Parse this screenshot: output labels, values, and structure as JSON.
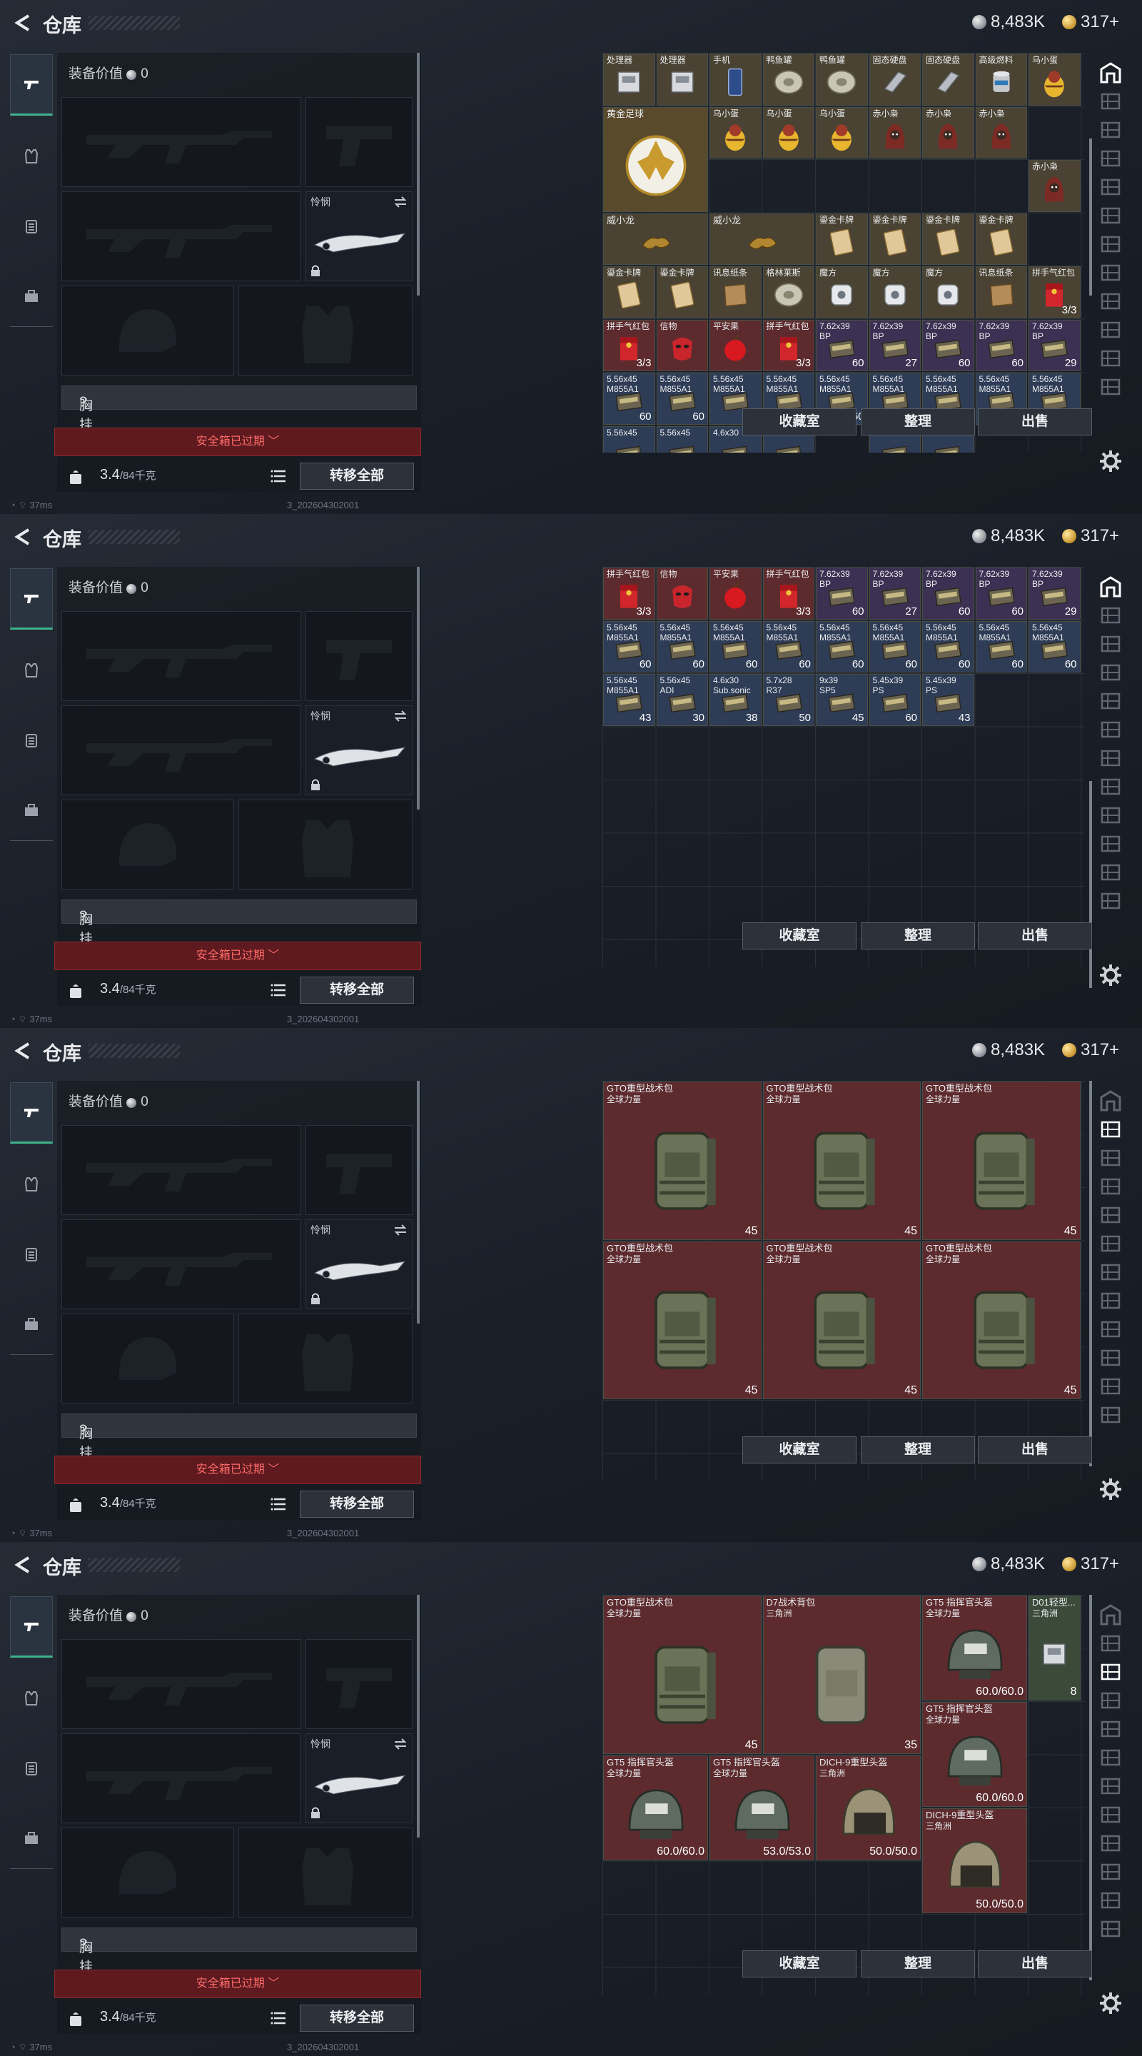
{
  "header": {
    "title": "仓库",
    "silver": "8,483K",
    "gold": "317+"
  },
  "equip": {
    "value_label": "装备价值",
    "value": "0",
    "knife_label": "怜悯",
    "chest_label": "胸挂",
    "chest_value": "?",
    "expired_label": "安全箱已过期",
    "weight": "3.4",
    "weight_cap": "/84千克",
    "transfer_all": "转移全部"
  },
  "status": {
    "ping": "37ms",
    "build": "3_202604302001"
  },
  "buttons": {
    "collect": "收藏室",
    "sort": "整理",
    "sell": "出售"
  },
  "colors": {
    "accent": "#3fb28b",
    "expired_bg": "#5e1a1e",
    "expired_text": "#ff6b6b"
  },
  "panels": [
    {
      "items": [
        {
          "r": 0,
          "c": 0,
          "name": "处理器",
          "t": "t-brown",
          "art": "box"
        },
        {
          "r": 0,
          "c": 1,
          "name": "处理器",
          "t": "t-brown",
          "art": "box"
        },
        {
          "r": 0,
          "c": 2,
          "name": "手机",
          "t": "t-brown",
          "art": "phone"
        },
        {
          "r": 0,
          "c": 3,
          "name": "鸭鱼罐",
          "t": "t-brown",
          "art": "disk"
        },
        {
          "r": 0,
          "c": 4,
          "name": "鸭鱼罐",
          "t": "t-brown",
          "art": "disk"
        },
        {
          "r": 0,
          "c": 5,
          "name": "固态硬盘",
          "t": "t-brown",
          "art": "bar"
        },
        {
          "r": 0,
          "c": 6,
          "name": "固态硬盘",
          "t": "t-brown",
          "art": "bar"
        },
        {
          "r": 0,
          "c": 7,
          "name": "高级燃料",
          "t": "t-brown",
          "art": "can"
        },
        {
          "r": 0,
          "c": 8,
          "name": "乌小蛋",
          "t": "t-brown",
          "art": "egg"
        },
        {
          "r": 1,
          "c": 0,
          "w": 2,
          "h": 2,
          "name": "黄金足球",
          "t": "t-gold",
          "art": "ball"
        },
        {
          "r": 1,
          "c": 2,
          "name": "乌小蛋",
          "t": "t-brown",
          "art": "egg"
        },
        {
          "r": 1,
          "c": 3,
          "name": "乌小蛋",
          "t": "t-brown",
          "art": "egg"
        },
        {
          "r": 1,
          "c": 4,
          "name": "乌小蛋",
          "t": "t-brown",
          "art": "egg"
        },
        {
          "r": 1,
          "c": 5,
          "name": "赤小枭",
          "t": "t-brown",
          "art": "hood"
        },
        {
          "r": 1,
          "c": 6,
          "name": "赤小枭",
          "t": "t-brown",
          "art": "hood"
        },
        {
          "r": 1,
          "c": 7,
          "name": "赤小枭",
          "t": "t-brown",
          "art": "hood"
        },
        {
          "r": 2,
          "c": 8,
          "name": "赤小枭",
          "t": "t-brown",
          "art": "hood"
        },
        {
          "r": 3,
          "c": 0,
          "w": 2,
          "name": "威小龙",
          "t": "t-brown",
          "art": "dragon"
        },
        {
          "r": 3,
          "c": 2,
          "w": 2,
          "name": "威小龙",
          "t": "t-brown",
          "art": "dragon"
        },
        {
          "r": 3,
          "c": 4,
          "name": "鎏金卡牌",
          "t": "t-brown",
          "art": "card"
        },
        {
          "r": 3,
          "c": 5,
          "name": "鎏金卡牌",
          "t": "t-brown",
          "art": "card"
        },
        {
          "r": 3,
          "c": 6,
          "name": "鎏金卡牌",
          "t": "t-brown",
          "art": "card"
        },
        {
          "r": 3,
          "c": 7,
          "name": "鎏金卡牌",
          "t": "t-brown",
          "art": "card"
        },
        {
          "r": 4,
          "c": 0,
          "name": "鎏金卡牌",
          "t": "t-brown",
          "art": "card"
        },
        {
          "r": 4,
          "c": 1,
          "name": "鎏金卡牌",
          "t": "t-brown",
          "art": "card"
        },
        {
          "r": 4,
          "c": 2,
          "name": "讯息纸条",
          "t": "t-brown",
          "art": "paper"
        },
        {
          "r": 4,
          "c": 3,
          "name": "格林莱斯",
          "t": "t-brown",
          "art": "disk"
        },
        {
          "r": 4,
          "c": 4,
          "name": "魔方",
          "t": "t-brown",
          "art": "cube"
        },
        {
          "r": 4,
          "c": 5,
          "name": "魔方",
          "t": "t-brown",
          "art": "cube"
        },
        {
          "r": 4,
          "c": 6,
          "name": "魔方",
          "t": "t-brown",
          "art": "cube"
        },
        {
          "r": 4,
          "c": 7,
          "name": "讯息纸条",
          "t": "t-brown",
          "art": "paper"
        },
        {
          "r": 4,
          "c": 8,
          "name": "拼手气红包",
          "t": "t-brown",
          "art": "red",
          "ct": "3/3"
        },
        {
          "r": 5,
          "c": 0,
          "name": "拼手气红包",
          "t": "t-red",
          "art": "red",
          "ct": "3/3"
        },
        {
          "r": 5,
          "c": 1,
          "name": "信物",
          "t": "t-red",
          "art": "mask"
        },
        {
          "r": 5,
          "c": 2,
          "name": "平安果",
          "t": "t-red",
          "art": "apple"
        },
        {
          "r": 5,
          "c": 3,
          "name": "拼手气红包",
          "t": "t-red",
          "art": "red",
          "ct": "3/3"
        },
        {
          "r": 5,
          "c": 4,
          "name": "7.62x39",
          "name2": "BP",
          "t": "t-purple",
          "art": "ammo",
          "ct": "60"
        },
        {
          "r": 5,
          "c": 5,
          "name": "7.62x39",
          "name2": "BP",
          "t": "t-purple",
          "art": "ammo",
          "ct": "27"
        },
        {
          "r": 5,
          "c": 6,
          "name": "7.62x39",
          "name2": "BP",
          "t": "t-purple",
          "art": "ammo",
          "ct": "60"
        },
        {
          "r": 5,
          "c": 7,
          "name": "7.62x39",
          "name2": "BP",
          "t": "t-purple",
          "art": "ammo",
          "ct": "60"
        },
        {
          "r": 5,
          "c": 8,
          "name": "7.62x39",
          "name2": "BP",
          "t": "t-purple",
          "art": "ammo",
          "ct": "29"
        },
        {
          "r": 6,
          "c": 0,
          "name": "5.56x45",
          "name2": "M855A1",
          "t": "t-blue",
          "art": "ammo",
          "ct": "60"
        },
        {
          "r": 6,
          "c": 1,
          "name": "5.56x45",
          "name2": "M855A1",
          "t": "t-blue",
          "art": "ammo",
          "ct": "60"
        },
        {
          "r": 6,
          "c": 2,
          "name": "5.56x45",
          "name2": "M855A1",
          "t": "t-blue",
          "art": "ammo",
          "ct": "60"
        },
        {
          "r": 6,
          "c": 3,
          "name": "5.56x45",
          "name2": "M855A1",
          "t": "t-blue",
          "art": "ammo",
          "ct": "60"
        },
        {
          "r": 6,
          "c": 4,
          "name": "5.56x45",
          "name2": "M855A1",
          "t": "t-blue",
          "art": "ammo",
          "ct": "60"
        },
        {
          "r": 6,
          "c": 5,
          "name": "5.56x45",
          "name2": "M855A1",
          "t": "t-blue",
          "art": "ammo",
          "ct": "60"
        },
        {
          "r": 6,
          "c": 6,
          "name": "5.56x45",
          "name2": "M855A1",
          "t": "t-blue",
          "art": "ammo",
          "ct": "60"
        },
        {
          "r": 6,
          "c": 7,
          "name": "5.56x45",
          "name2": "M855A1",
          "t": "t-blue",
          "art": "ammo",
          "ct": "60"
        },
        {
          "r": 6,
          "c": 8,
          "name": "5.56x45",
          "name2": "M855A1",
          "t": "t-blue",
          "art": "ammo",
          "ct": "60"
        },
        {
          "r": 7,
          "c": 0,
          "name": "5.56x45",
          "t": "t-blue",
          "art": "ammo"
        },
        {
          "r": 7,
          "c": 1,
          "name": "5.56x45",
          "t": "t-blue",
          "art": "ammo"
        },
        {
          "r": 7,
          "c": 2,
          "name": "4.6x30",
          "t": "t-blue",
          "art": "ammo"
        },
        {
          "r": 7,
          "c": 3,
          "name": "5.7x28",
          "t": "t-blue",
          "art": "ammo"
        },
        {
          "r": 7,
          "c": 5,
          "name": "5.45x39",
          "t": "t-blue",
          "art": "ammo"
        },
        {
          "r": 7,
          "c": 6,
          "name": "5.45x39",
          "t": "t-blue",
          "art": "ammo"
        }
      ]
    },
    {
      "items": [
        {
          "r": 0,
          "c": 0,
          "name": "拼手气红包",
          "t": "t-red",
          "art": "red",
          "ct": "3/3"
        },
        {
          "r": 0,
          "c": 1,
          "name": "信物",
          "t": "t-red",
          "art": "mask"
        },
        {
          "r": 0,
          "c": 2,
          "name": "平安果",
          "t": "t-red",
          "art": "apple"
        },
        {
          "r": 0,
          "c": 3,
          "name": "拼手气红包",
          "t": "t-red",
          "art": "red",
          "ct": "3/3"
        },
        {
          "r": 0,
          "c": 4,
          "name": "7.62x39",
          "name2": "BP",
          "t": "t-purple",
          "art": "ammo",
          "ct": "60"
        },
        {
          "r": 0,
          "c": 5,
          "name": "7.62x39",
          "name2": "BP",
          "t": "t-purple",
          "art": "ammo",
          "ct": "27"
        },
        {
          "r": 0,
          "c": 6,
          "name": "7.62x39",
          "name2": "BP",
          "t": "t-purple",
          "art": "ammo",
          "ct": "60"
        },
        {
          "r": 0,
          "c": 7,
          "name": "7.62x39",
          "name2": "BP",
          "t": "t-purple",
          "art": "ammo",
          "ct": "60"
        },
        {
          "r": 0,
          "c": 8,
          "name": "7.62x39",
          "name2": "BP",
          "t": "t-purple",
          "art": "ammo",
          "ct": "29"
        },
        {
          "r": 1,
          "c": 0,
          "name": "5.56x45",
          "name2": "M855A1",
          "t": "t-blue",
          "art": "ammo",
          "ct": "60"
        },
        {
          "r": 1,
          "c": 1,
          "name": "5.56x45",
          "name2": "M855A1",
          "t": "t-blue",
          "art": "ammo",
          "ct": "60"
        },
        {
          "r": 1,
          "c": 2,
          "name": "5.56x45",
          "name2": "M855A1",
          "t": "t-blue",
          "art": "ammo",
          "ct": "60"
        },
        {
          "r": 1,
          "c": 3,
          "name": "5.56x45",
          "name2": "M855A1",
          "t": "t-blue",
          "art": "ammo",
          "ct": "60"
        },
        {
          "r": 1,
          "c": 4,
          "name": "5.56x45",
          "name2": "M855A1",
          "t": "t-blue",
          "art": "ammo",
          "ct": "60"
        },
        {
          "r": 1,
          "c": 5,
          "name": "5.56x45",
          "name2": "M855A1",
          "t": "t-blue",
          "art": "ammo",
          "ct": "60"
        },
        {
          "r": 1,
          "c": 6,
          "name": "5.56x45",
          "name2": "M855A1",
          "t": "t-blue",
          "art": "ammo",
          "ct": "60"
        },
        {
          "r": 1,
          "c": 7,
          "name": "5.56x45",
          "name2": "M855A1",
          "t": "t-blue",
          "art": "ammo",
          "ct": "60"
        },
        {
          "r": 1,
          "c": 8,
          "name": "5.56x45",
          "name2": "M855A1",
          "t": "t-blue",
          "art": "ammo",
          "ct": "60"
        },
        {
          "r": 2,
          "c": 0,
          "name": "5.56x45",
          "name2": "M855A1",
          "t": "t-blue",
          "art": "ammo",
          "ct": "43"
        },
        {
          "r": 2,
          "c": 1,
          "name": "5.56x45",
          "name2": "ADI",
          "t": "t-blue",
          "art": "ammo",
          "ct": "30"
        },
        {
          "r": 2,
          "c": 2,
          "name": "4.6x30",
          "name2": "Sub.sonic",
          "t": "t-blue",
          "art": "ammo",
          "ct": "38"
        },
        {
          "r": 2,
          "c": 3,
          "name": "5.7x28",
          "name2": "R37",
          "t": "t-blue",
          "art": "ammo",
          "ct": "50"
        },
        {
          "r": 2,
          "c": 4,
          "name": "9x39",
          "name2": "SP5",
          "t": "t-blue",
          "art": "ammo",
          "ct": "45"
        },
        {
          "r": 2,
          "c": 5,
          "name": "5.45x39",
          "name2": "PS",
          "t": "t-blue",
          "art": "ammo",
          "ct": "60"
        },
        {
          "r": 2,
          "c": 6,
          "name": "5.45x39",
          "name2": "PS",
          "t": "t-blue",
          "art": "ammo",
          "ct": "43"
        }
      ]
    },
    {
      "items": [
        {
          "r": 0,
          "c": 0,
          "w": 3,
          "h": 3,
          "name": "GTO重型战术包",
          "name2": "全球力量",
          "t": "t-red",
          "art": "pack",
          "ct": "45"
        },
        {
          "r": 0,
          "c": 3,
          "w": 3,
          "h": 3,
          "name": "GTO重型战术包",
          "name2": "全球力量",
          "t": "t-red",
          "art": "pack",
          "ct": "45"
        },
        {
          "r": 0,
          "c": 6,
          "w": 3,
          "h": 3,
          "name": "GTO重型战术包",
          "name2": "全球力量",
          "t": "t-red",
          "art": "pack",
          "ct": "45"
        },
        {
          "r": 3,
          "c": 0,
          "w": 3,
          "h": 3,
          "name": "GTO重型战术包",
          "name2": "全球力量",
          "t": "t-red",
          "art": "pack",
          "ct": "45"
        },
        {
          "r": 3,
          "c": 3,
          "w": 3,
          "h": 3,
          "name": "GTO重型战术包",
          "name2": "全球力量",
          "t": "t-red",
          "art": "pack",
          "ct": "45"
        },
        {
          "r": 3,
          "c": 6,
          "w": 3,
          "h": 3,
          "name": "GTO重型战术包",
          "name2": "全球力量",
          "t": "t-red",
          "art": "pack",
          "ct": "45"
        }
      ]
    },
    {
      "items": [
        {
          "r": 0,
          "c": 0,
          "w": 3,
          "h": 3,
          "name": "GTO重型战术包",
          "name2": "全球力量",
          "t": "t-red",
          "art": "pack",
          "ct": "45"
        },
        {
          "r": 0,
          "c": 3,
          "w": 3,
          "h": 3,
          "name": "D7战术背包",
          "name2": "三角洲",
          "t": "t-red",
          "art": "pack2",
          "ct": "35"
        },
        {
          "r": 0,
          "c": 6,
          "w": 2,
          "h": 2,
          "name": "GT5 指挥官头盔",
          "name2": "全球力量",
          "t": "t-red",
          "art": "helmet",
          "ct": "60.0/60.0"
        },
        {
          "r": 0,
          "c": 8,
          "w": 1,
          "h": 2,
          "name": "D01轻型...",
          "name2": "三角洲",
          "t": "t-green",
          "art": "box",
          "ct": "8"
        },
        {
          "r": 2,
          "c": 6,
          "w": 2,
          "h": 2,
          "name": "GT5 指挥官头盔",
          "name2": "全球力量",
          "t": "t-red",
          "art": "helmet",
          "ct": "60.0/60.0"
        },
        {
          "r": 3,
          "c": 0,
          "w": 2,
          "h": 2,
          "name": "GT5 指挥官头盔",
          "name2": "全球力量",
          "t": "t-red",
          "art": "helmet",
          "ct": "60.0/60.0"
        },
        {
          "r": 3,
          "c": 2,
          "w": 2,
          "h": 2,
          "name": "GT5 指挥官头盔",
          "name2": "全球力量",
          "t": "t-red",
          "art": "helmet",
          "ct": "53.0/53.0"
        },
        {
          "r": 3,
          "c": 4,
          "w": 2,
          "h": 2,
          "name": "DICH-9重型头盔",
          "name2": "三角洲",
          "t": "t-red",
          "art": "helmet2",
          "ct": "50.0/50.0"
        },
        {
          "r": 4,
          "c": 6,
          "w": 2,
          "h": 2,
          "name": "DICH-9重型头盔",
          "name2": "三角洲",
          "t": "t-red",
          "art": "helmet2",
          "ct": "50.0/50.0"
        }
      ]
    }
  ]
}
